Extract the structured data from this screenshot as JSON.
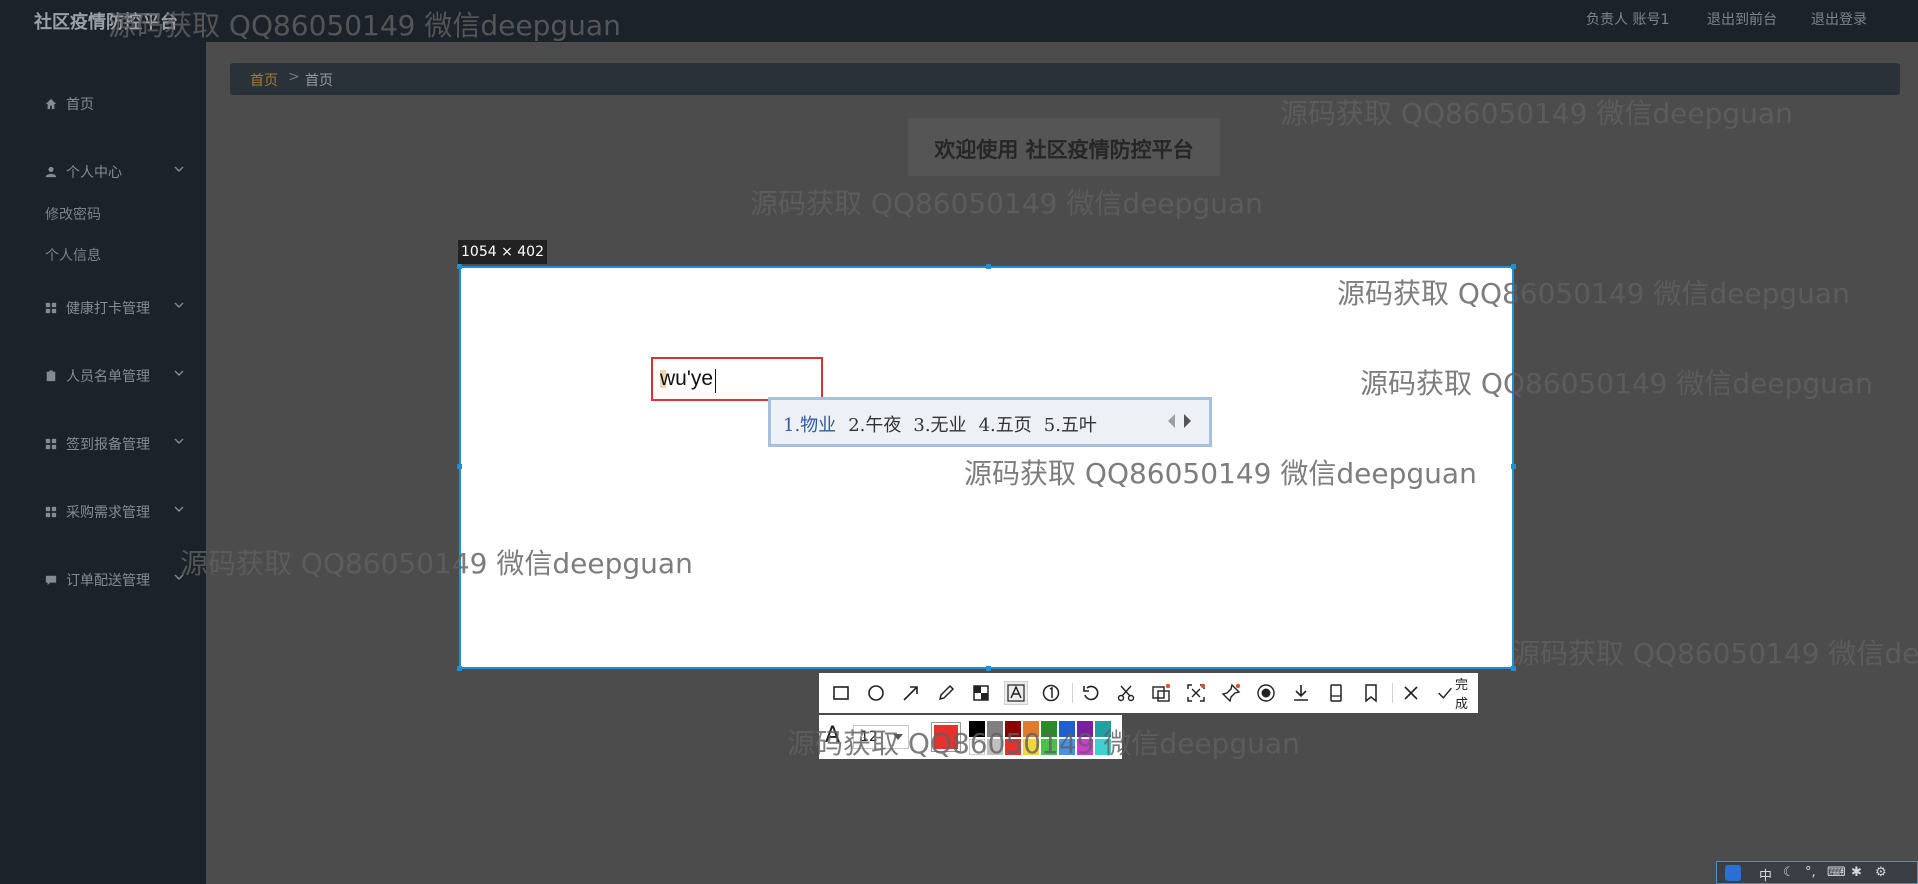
{
  "app": {
    "title": "社区疫情防控平台",
    "top_links": [
      "负责人  账号1",
      "退出到前台",
      "退出登录"
    ]
  },
  "sidebar": {
    "items": [
      {
        "label": "首页",
        "icon": "home-icon"
      },
      {
        "label": "个人中心",
        "icon": "user-icon"
      },
      {
        "label": "健康打卡管理",
        "icon": "grid-icon"
      },
      {
        "label": "人员名单管理",
        "icon": "clipboard-icon"
      },
      {
        "label": "签到报备管理",
        "icon": "grid-icon"
      },
      {
        "label": "采购需求管理",
        "icon": "grid-icon"
      },
      {
        "label": "订单配送管理",
        "icon": "comment-icon"
      }
    ],
    "submenu": [
      "修改密码",
      "个人信息"
    ]
  },
  "breadcrumb": {
    "home": "首页",
    "separator": ">",
    "current": "首页"
  },
  "welcome": "欢迎使用  社区疫情防控平台",
  "capture": {
    "size_label": "1054 × 402",
    "text_value": "wu'ye",
    "ime_candidates": [
      "1.物业",
      "2.午夜",
      "3.无业",
      "4.五页",
      "5.五叶"
    ]
  },
  "toolbar": {
    "tools": [
      "rectangle-icon",
      "ellipse-icon",
      "arrow-icon",
      "pen-icon",
      "mosaic-icon",
      "text-icon",
      "number-icon",
      "undo-icon",
      "cut-icon",
      "ocr-icon",
      "scan-icon",
      "pin-icon",
      "record-icon",
      "download-icon",
      "long-shot-icon",
      "bookmark-icon",
      "close-icon"
    ],
    "done_label": "完成",
    "font_size": "12",
    "active_color": "#e8302c",
    "palette": [
      "#000000",
      "#808080",
      "#8b0000",
      "#e07a2c",
      "#2a8a2a",
      "#1f5fcf",
      "#7a1fa0",
      "#20a0a0",
      "#ffffff",
      "#c0c0c0",
      "#e8302c",
      "#f5d63a",
      "#4cc04c",
      "#4a90e8",
      "#d03ad0",
      "#40d0d0"
    ]
  },
  "taskbar": [
    "中",
    "☾",
    "°,",
    "⌨",
    "✱",
    "⚙"
  ],
  "watermark": "源码获取 QQ86050149 微信deepguan"
}
